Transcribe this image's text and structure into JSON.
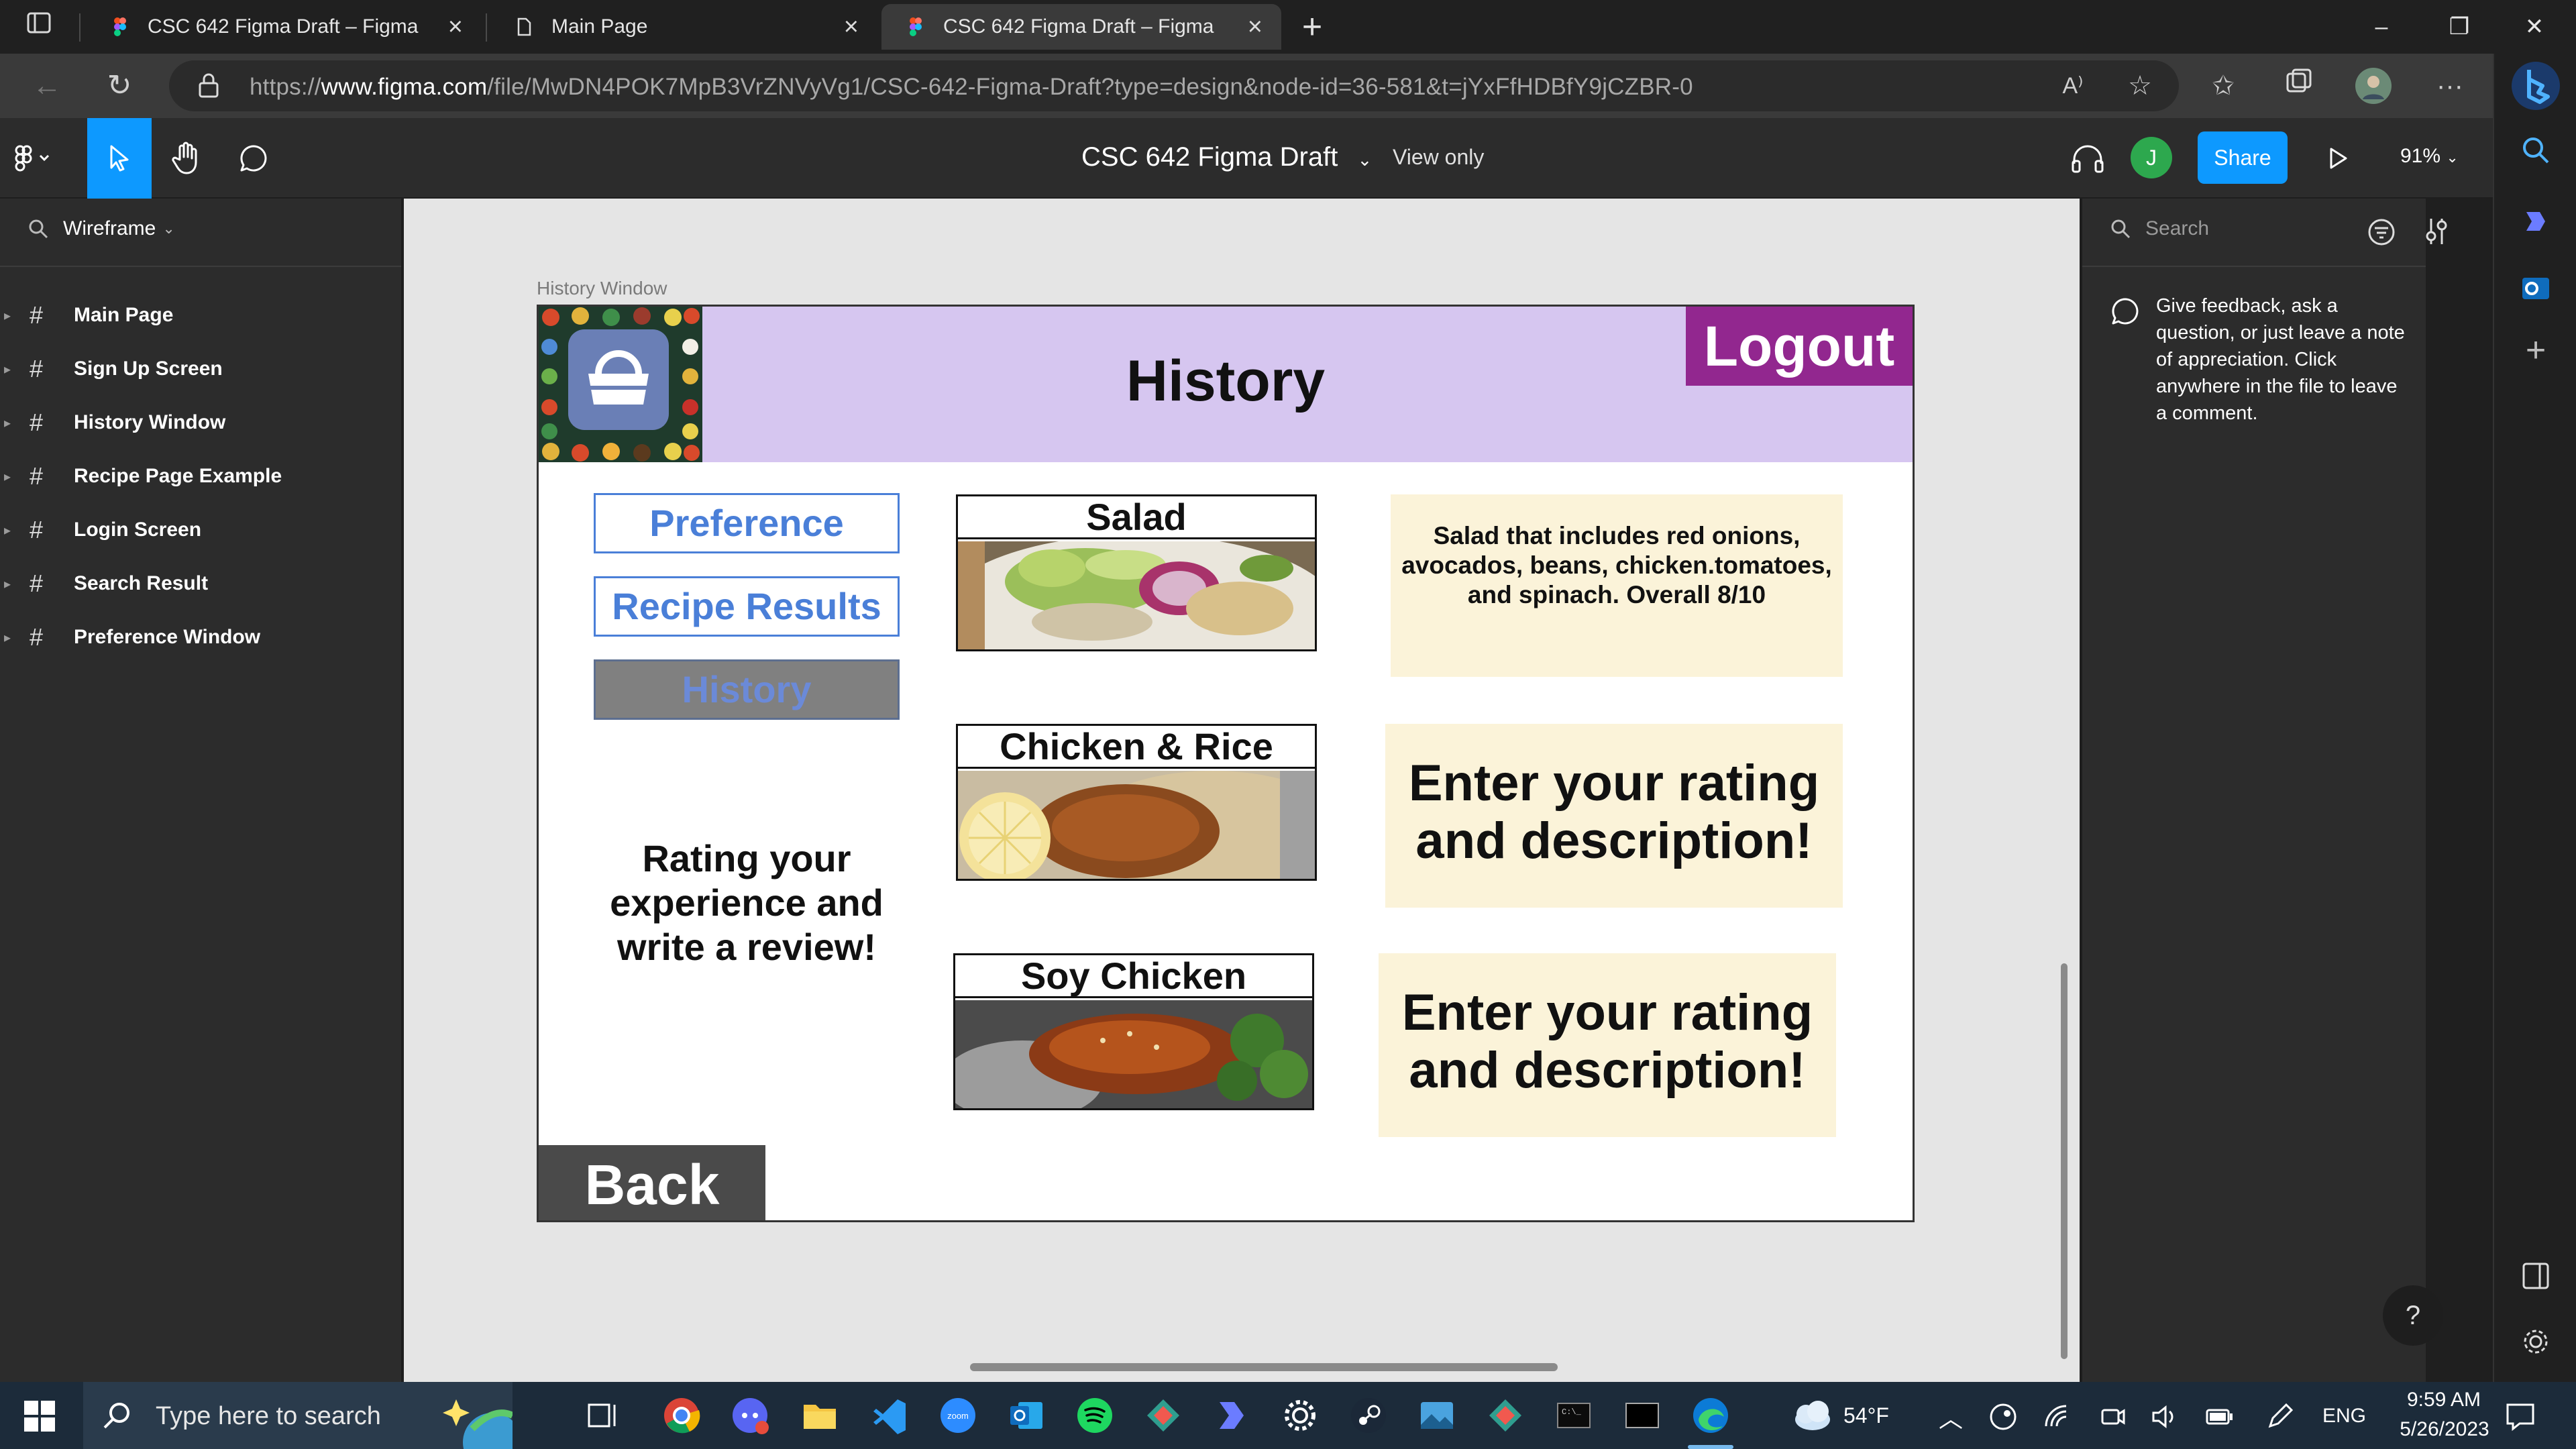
{
  "browser": {
    "tabs": [
      {
        "label": "CSC 642 Figma Draft – Figma",
        "icon": "figma-icon"
      },
      {
        "label": "Main Page",
        "icon": "page-icon"
      },
      {
        "label": "CSC 642 Figma Draft – Figma",
        "icon": "figma-icon"
      }
    ],
    "url_prefix": "https://",
    "url_domain": "www.figma.com",
    "url_path": "/file/MwDN4POK7MpB3VrZNVyVg1/CSC-642-Figma-Draft?type=design&node-id=36-581&t=jYxFfHDBfY9jCZBR-0"
  },
  "figma": {
    "doc_title": "CSC 642 Figma Draft",
    "view_mode": "View only",
    "avatar_initial": "J",
    "share_label": "Share",
    "zoom": "91%"
  },
  "left_panel": {
    "page_selector": "Wireframe",
    "layers": [
      "Main Page",
      "Sign Up Screen",
      "History Window",
      "Recipe Page Example",
      "Login Screen",
      "Search Result",
      "Preference Window"
    ]
  },
  "frame": {
    "label": "History Window",
    "title": "History",
    "logout": "Logout",
    "nav": [
      "Preference",
      "Recipe Results",
      "History"
    ],
    "rating_prompt": "Rating your experience and write a review!",
    "cards": [
      {
        "title": "Salad",
        "note": "Salad that includes red onions, avocados, beans, chicken.tomatoes, and spinach. Overall 8/10"
      },
      {
        "title": "Chicken & Rice",
        "note": "Enter your rating and description!"
      },
      {
        "title": "Soy Chicken",
        "note": "Enter your rating and description!"
      }
    ],
    "back": "Back"
  },
  "right_panel": {
    "search_placeholder": "Search",
    "comment_hint": "Give feedback, ask a question, or just leave a note of appreciation. Click anywhere in the file to leave a comment."
  },
  "taskbar": {
    "search_placeholder": "Type here to search",
    "weather": "54°F",
    "language": "ENG",
    "time": "9:59 AM",
    "date": "5/26/2023"
  },
  "colors": {
    "figma_accent": "#0d99ff",
    "header_lavender": "#d6c6f0",
    "logout_purple": "#92278f",
    "nav_blue": "#4a7fd8",
    "note_cream": "#fbf3d9"
  }
}
